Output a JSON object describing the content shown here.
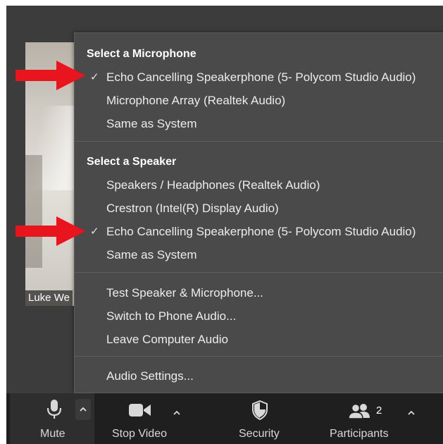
{
  "video": {
    "participant_name": "Luke We"
  },
  "menu": {
    "microphone_header": "Select a Microphone",
    "microphones": [
      {
        "label": "Echo Cancelling Speakerphone (5- Polycom Studio Audio)",
        "checked": true
      },
      {
        "label": "Microphone Array (Realtek Audio)",
        "checked": false
      },
      {
        "label": "Same as System",
        "checked": false
      }
    ],
    "speaker_header": "Select a Speaker",
    "speakers": [
      {
        "label": "Speakers / Headphones (Realtek Audio)",
        "checked": false
      },
      {
        "label": "Crestron (Intel(R) Display Audio)",
        "checked": false
      },
      {
        "label": "Echo Cancelling Speakerphone (5- Polycom Studio Audio)",
        "checked": true
      },
      {
        "label": "Same as System",
        "checked": false
      }
    ],
    "actions": [
      "Test Speaker & Microphone...",
      "Switch to Phone Audio...",
      "Leave Computer Audio"
    ],
    "settings": "Audio Settings...",
    "check_glyph": "✓"
  },
  "toolbar": {
    "mute_label": "Mute",
    "stop_video_label": "Stop Video",
    "security_label": "Security",
    "participants_label": "Participants",
    "participants_count": "2",
    "icons": [
      "microphone-icon",
      "video-camera-icon",
      "shield-icon",
      "participants-icon",
      "chevron-up-icon"
    ]
  },
  "colors": {
    "menu_background": "#4a4a4a",
    "app_background": "#3c3c3c",
    "toolbar_background": "#1f1f1f",
    "annotation_arrow": "#e8141e"
  }
}
